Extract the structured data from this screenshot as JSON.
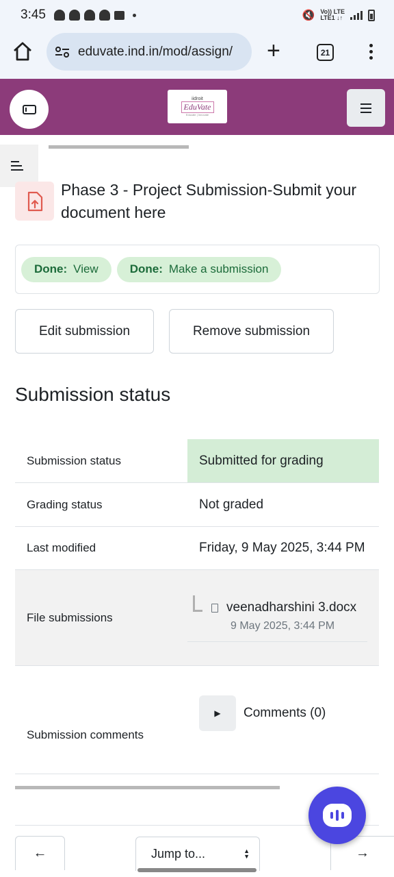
{
  "status_bar": {
    "time": "3:45",
    "notification_icons": [
      "snapchat-icon",
      "snapchat-icon",
      "snapchat-icon",
      "snapchat-icon",
      "message-icon"
    ],
    "network_label_top": "Vo)) LTE",
    "network_label_bottom": "LTE1 ↓↑"
  },
  "browser": {
    "url": "eduvate.ind.in/mod/assign/",
    "tab_count": "21",
    "new_tab_symbol": "+"
  },
  "site_header": {
    "logo_top": "iidroit",
    "logo_name": "EduVate",
    "logo_tagline": "Educate | Innovate"
  },
  "activity": {
    "title": "Phase 3 - Project Submission-Submit your document here"
  },
  "completion": [
    {
      "status": "Done:",
      "text": "View"
    },
    {
      "status": "Done:",
      "text": "Make a submission"
    }
  ],
  "actions": {
    "edit": "Edit submission",
    "remove": "Remove submission"
  },
  "submission_status": {
    "heading": "Submission status",
    "rows": [
      {
        "label": "Submission status",
        "value": "Submitted for grading"
      },
      {
        "label": "Grading status",
        "value": "Not graded"
      },
      {
        "label": "Last modified",
        "value": "Friday, 9 May 2025, 3:44 PM"
      },
      {
        "label": "File submissions",
        "file_name": "veenadharshini 3.docx",
        "file_date": "9 May 2025, 3:44 PM"
      },
      {
        "label": "Submission comments",
        "value": "Comments (0)"
      }
    ]
  },
  "footer_nav": {
    "prev_symbol": "←",
    "jump_label": "Jump to...",
    "next_symbol": "→"
  },
  "colors": {
    "header": "#8c3b7a",
    "status_green": "#d4edd6",
    "badge_green": "#d7f0d7",
    "fab": "#4b46e0"
  }
}
